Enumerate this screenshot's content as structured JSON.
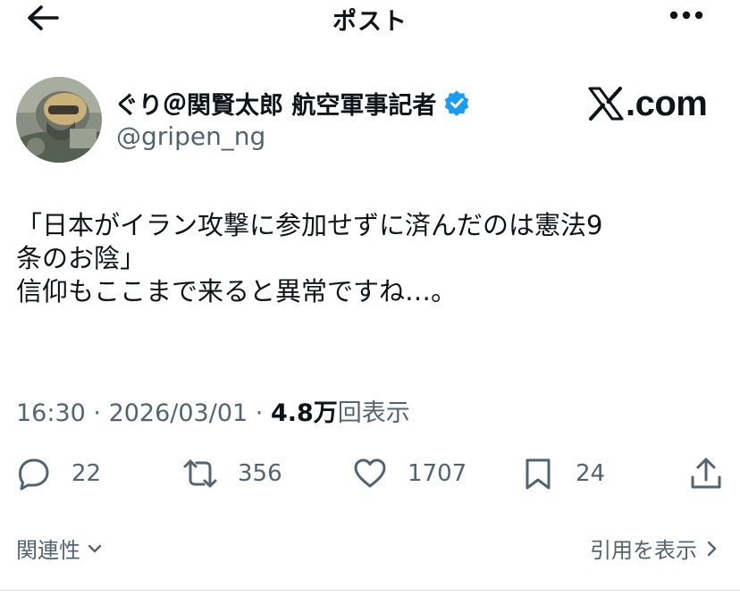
{
  "header": {
    "title": "ポスト",
    "back_icon": "arrow-left-icon",
    "more_icon": "more-horizontal-icon"
  },
  "author": {
    "display_name": "ぐり＠関賢太郎 航空軍事記者",
    "handle": "@gripen_ng",
    "verified": true,
    "verified_color": "#1d9bf0"
  },
  "watermark": {
    "text": ".com"
  },
  "tweet": {
    "lines": [
      "「日本がイラン攻撃に参加せずに済んだのは憲法9",
      "条のお陰」",
      "信仰もここまで来ると異常ですね…。"
    ]
  },
  "meta": {
    "time": "16:30",
    "sep1": " · ",
    "date": "2026/03/01",
    "sep2": " · ",
    "views": "4.8万",
    "views_label": "回表示"
  },
  "actions": {
    "replies": "22",
    "reposts": "356",
    "likes": "1707",
    "bookmarks": "24"
  },
  "footer": {
    "related_label": "関連性",
    "quotes_label": "引用を表示"
  },
  "colors": {
    "text": "#0f1419",
    "secondary": "#536471",
    "accent": "#1d9bf0"
  }
}
